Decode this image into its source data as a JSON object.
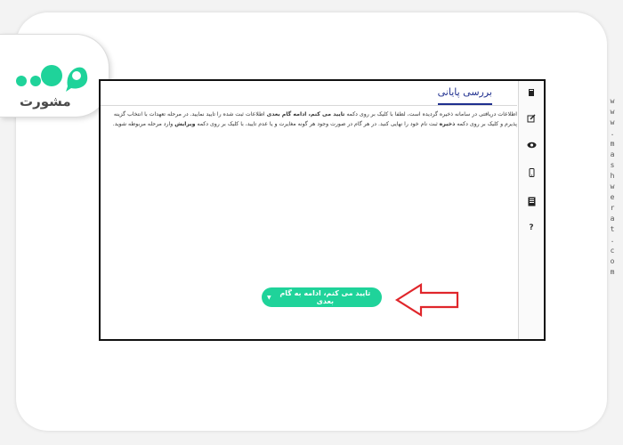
{
  "brand": {
    "name": "مشورت",
    "side_url_chars": [
      "w",
      "w",
      "w",
      ".",
      "m",
      "a",
      "s",
      "h",
      "w",
      "e",
      "r",
      "a",
      "t",
      ".",
      "c",
      "o",
      "m"
    ]
  },
  "panel": {
    "title": "بررسی پایانی",
    "description_lines": [
      [
        "اطلاعات دریافتی در سامانه ذخیره گردیده است، لطفا با کلیک بر روی دکمه ",
        "تایید می کنم، ادامه گام بعدی",
        " اطلاعات ثبت شده را تایید نمایید. در مرحله تعهدات با انتخاب گزینه"
      ],
      [
        "پذیرم و کلیک بر روی دکمه ",
        "ذخیره",
        " ثبت نام خود را نهایی کنید. در هر گام در صورت وجود هر گونه مغایرت و یا عدم تایید، با کلیک بر روی دکمه ",
        "ویرایش",
        " وارد مرحله مربوطه شوید."
      ]
    ],
    "confirm_button": "تایید می کنم، ادامه به گام بعدی"
  },
  "sidebar": {
    "icons": [
      "book-icon",
      "edit-icon",
      "eye-icon",
      "mobile-icon",
      "document-icon",
      "help-icon"
    ],
    "help_glyph": "?"
  },
  "colors": {
    "accent": "#1fd39a",
    "title_blue": "#1f2f8f",
    "arrow_red": "#e0262b"
  }
}
